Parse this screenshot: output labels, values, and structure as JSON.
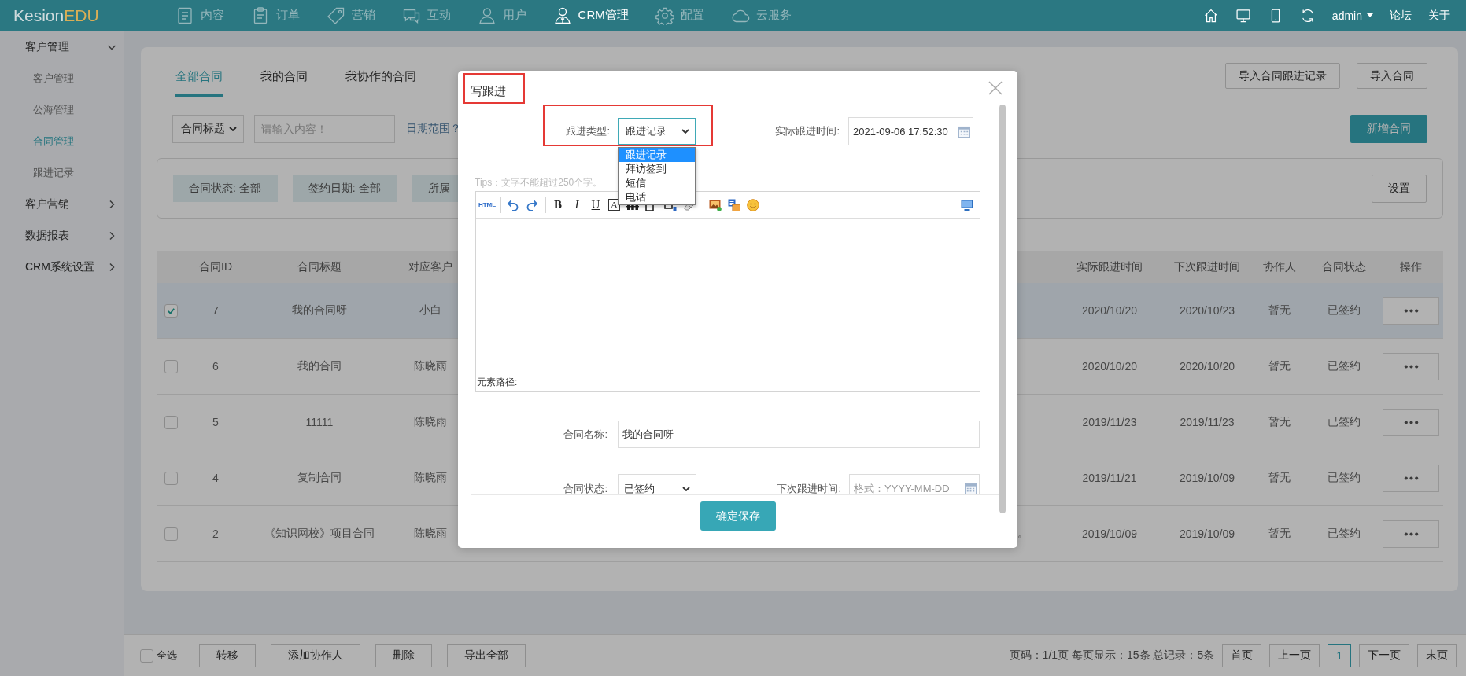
{
  "top_bar": {
    "logo": {
      "main": "Kesion",
      "accent": "EDU"
    },
    "nav": [
      {
        "label": "内容",
        "kind": "document",
        "selected": false
      },
      {
        "label": "订单",
        "kind": "clipboard",
        "selected": false
      },
      {
        "label": "营销",
        "kind": "tag",
        "selected": false
      },
      {
        "label": "互动",
        "kind": "chat",
        "selected": false
      },
      {
        "label": "用户",
        "kind": "user",
        "selected": false
      },
      {
        "label": "CRM管理",
        "kind": "manager",
        "selected": true
      },
      {
        "label": "配置",
        "kind": "gear",
        "selected": false
      },
      {
        "label": "云服务",
        "kind": "cloud",
        "selected": false
      }
    ],
    "user_menu": "admin",
    "links": [
      "论坛",
      "关于"
    ]
  },
  "sidebar": {
    "groups": [
      {
        "label": "客户管理",
        "expanded": true,
        "children": [
          {
            "label": "客户管理",
            "selected": false
          },
          {
            "label": "公海管理",
            "selected": false
          },
          {
            "label": "合同管理",
            "selected": true
          },
          {
            "label": "跟进记录",
            "selected": false
          }
        ]
      },
      {
        "label": "客户营销",
        "expanded": false
      },
      {
        "label": "数据报表",
        "expanded": false
      },
      {
        "label": "CRM系统设置",
        "expanded": false
      }
    ]
  },
  "tabs": [
    {
      "label": "全部合同",
      "selected": true
    },
    {
      "label": "我的合同",
      "selected": false
    },
    {
      "label": "我协作的合同",
      "selected": false
    }
  ],
  "import_buttons": [
    "导入合同跟进记录",
    "导入合同"
  ],
  "filter": {
    "field": "合同标题",
    "search_placeholder": "请输入内容！",
    "date_label": "日期范围？",
    "add_button": "新增合同",
    "chips": [
      "合同状态: 全部",
      "签约日期: 全部",
      "所属"
    ],
    "settings_button": "设置"
  },
  "table": {
    "columns": [
      "合同ID",
      "合同标题",
      "对应客户",
      "实际跟进时间",
      "下次跟进时间",
      "协作人",
      "合同状态",
      "操作"
    ],
    "rows": [
      {
        "checked": true,
        "id": "7",
        "title": "我的合同呀",
        "customer": "小白",
        "actual_follow_up": "2020/10/20",
        "next_follow_up": "2020/10/23",
        "collaborator": "暂无",
        "status": "已签约"
      },
      {
        "checked": false,
        "id": "6",
        "title": "我的合同",
        "customer": "陈晓雨",
        "actual_follow_up": "2020/10/20",
        "next_follow_up": "2020/10/20",
        "collaborator": "暂无",
        "status": "已签约"
      },
      {
        "checked": false,
        "id": "5",
        "title": "11111",
        "customer": "陈晓雨",
        "actual_follow_up": "2019/11/23",
        "next_follow_up": "2019/11/23",
        "collaborator": "暂无",
        "status": "已签约"
      },
      {
        "checked": false,
        "id": "4",
        "title": "复制合同",
        "customer": "陈晓雨",
        "actual_follow_up": "2019/11/21",
        "next_follow_up": "2019/10/09",
        "collaborator": "暂无",
        "status": "已签约"
      },
      {
        "checked": false,
        "id": "2",
        "title": "《知识网校》项目合同",
        "customer": "陈晓雨",
        "column_4": "。",
        "actual_follow_up": "2019/10/09",
        "next_follow_up": "2019/10/09",
        "collaborator": "暂无",
        "status": "已签约"
      }
    ]
  },
  "footer": {
    "select_all": {
      "label": "全选",
      "checked": false
    },
    "buttons": [
      "转移",
      "添加协作人",
      "删除",
      "导出全部"
    ],
    "page_info": "页码：1/1页 每页显示：15条 总记录：5条",
    "pages": [
      {
        "label": "首页",
        "selected": false
      },
      {
        "label": "上一页",
        "selected": false
      },
      {
        "label": "1",
        "selected": true
      },
      {
        "label": "下一页",
        "selected": false
      },
      {
        "label": "末页",
        "selected": false
      }
    ]
  },
  "modal": {
    "title": "写跟进",
    "title_highlighted": true,
    "follow_type": {
      "label": "跟进类型:",
      "value": "跟进记录",
      "highlighted": true,
      "expanded": true,
      "options": [
        {
          "label": "跟进记录",
          "selected": true
        },
        {
          "label": "拜访签到",
          "selected": false
        },
        {
          "label": "短信",
          "selected": false
        },
        {
          "label": "电话",
          "selected": false
        }
      ]
    },
    "actual_time": {
      "label": "实际跟进时间:",
      "value": "2021-09-06 17:52:30"
    },
    "tips": "Tips：文字不能超过250个字。",
    "editor": {
      "toolbar": [
        {
          "kind": "html",
          "label": "HTML"
        },
        {
          "kind": "separator"
        },
        {
          "kind": "undo"
        },
        {
          "kind": "redo"
        },
        {
          "kind": "separator"
        },
        {
          "kind": "bold",
          "label": "B"
        },
        {
          "kind": "italic",
          "label": "I"
        },
        {
          "kind": "underline",
          "label": "U"
        },
        {
          "kind": "boxed",
          "label": "A"
        },
        {
          "kind": "strike"
        },
        {
          "kind": "sup"
        },
        {
          "kind": "sub"
        },
        {
          "kind": "eraser"
        },
        {
          "kind": "separator"
        },
        {
          "kind": "image"
        },
        {
          "kind": "word"
        },
        {
          "kind": "emoji"
        },
        {
          "kind": "fullscreen"
        }
      ],
      "path_label": "元素路径:"
    },
    "contract_name": {
      "label": "合同名称:",
      "value": "我的合同呀"
    },
    "contract_status": {
      "label": "合同状态:",
      "value": "已签约"
    },
    "next_time": {
      "label": "下次跟进时间:",
      "placeholder": "格式：YYYY-MM-DD"
    },
    "save_button": "确定保存"
  }
}
